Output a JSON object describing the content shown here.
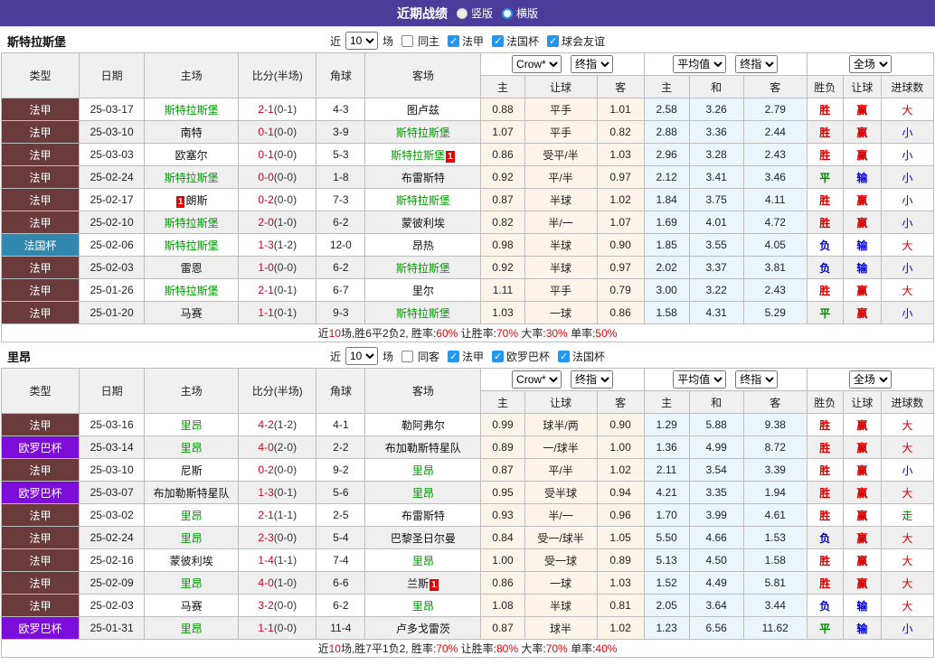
{
  "title_bar": {
    "title": "近期战绩",
    "options": [
      {
        "label": "竖版",
        "selected": true
      },
      {
        "label": "横版",
        "selected": false
      }
    ]
  },
  "colors": {
    "title_bar_bg": "#4b3c99",
    "focus_team": "#009900",
    "score_red": "#cc0022",
    "league_colors": {
      "法甲": "#6b3a3a",
      "法国杯": "#3187ad",
      "欧罗巴杯": "#7d0ddb"
    },
    "result_colors": {
      "胜": "#d60000",
      "赢": "#d60000",
      "大": "#d60000",
      "负": "#0000d6",
      "输": "#0000d6",
      "小": "#0000d6",
      "平": "#008800",
      "走": "#008800"
    }
  },
  "header": {
    "cols": [
      "类型",
      "日期",
      "主场",
      "比分(半场)",
      "角球",
      "客场"
    ],
    "selects": {
      "book": "Crow*",
      "final1": "终指",
      "avg": "平均值",
      "final2": "终指",
      "full": "全场"
    },
    "sub": [
      "主",
      "让球",
      "客",
      "主",
      "和",
      "客",
      "胜负",
      "让球",
      "进球数"
    ]
  },
  "sections": [
    {
      "team": "斯特拉斯堡",
      "filter": {
        "prefix": "近",
        "count": "10",
        "suffix": "场",
        "venue": "同主",
        "leagues": [
          "法甲",
          "法国杯",
          "球会友谊"
        ]
      },
      "rows": [
        {
          "type": "法甲",
          "date": "25-03-17",
          "home": {
            "name": "斯特拉斯堡",
            "focus": true
          },
          "score": "2-1",
          "half": "(0-1)",
          "corner": "4-3",
          "away": {
            "name": "图卢兹",
            "focus": false
          },
          "crow": [
            "0.88",
            "平手",
            "1.01"
          ],
          "avg": [
            "2.58",
            "3.26",
            "2.79"
          ],
          "result": [
            "胜",
            "赢",
            "大"
          ]
        },
        {
          "type": "法甲",
          "date": "25-03-10",
          "home": {
            "name": "南特",
            "focus": false
          },
          "score": "0-1",
          "half": "(0-0)",
          "corner": "3-9",
          "away": {
            "name": "斯特拉斯堡",
            "focus": true
          },
          "crow": [
            "1.07",
            "平手",
            "0.82"
          ],
          "avg": [
            "2.88",
            "3.36",
            "2.44"
          ],
          "result": [
            "胜",
            "赢",
            "小"
          ]
        },
        {
          "type": "法甲",
          "date": "25-03-03",
          "home": {
            "name": "欧塞尔",
            "focus": false
          },
          "score": "0-1",
          "half": "(0-0)",
          "corner": "5-3",
          "away": {
            "name": "斯特拉斯堡",
            "focus": true,
            "badge": "1",
            "badge_pos": "after"
          },
          "crow": [
            "0.86",
            "受平/半",
            "1.03"
          ],
          "avg": [
            "2.96",
            "3.28",
            "2.43"
          ],
          "result": [
            "胜",
            "赢",
            "小"
          ]
        },
        {
          "type": "法甲",
          "date": "25-02-24",
          "home": {
            "name": "斯特拉斯堡",
            "focus": true
          },
          "score": "0-0",
          "half": "(0-0)",
          "corner": "1-8",
          "away": {
            "name": "布雷斯特",
            "focus": false
          },
          "crow": [
            "0.92",
            "平/半",
            "0.97"
          ],
          "avg": [
            "2.12",
            "3.41",
            "3.46"
          ],
          "result": [
            "平",
            "输",
            "小"
          ]
        },
        {
          "type": "法甲",
          "date": "25-02-17",
          "home": {
            "name": "朗斯",
            "focus": false,
            "badge": "1",
            "badge_pos": "before"
          },
          "score": "0-2",
          "half": "(0-0)",
          "corner": "7-3",
          "away": {
            "name": "斯特拉斯堡",
            "focus": true
          },
          "crow": [
            "0.87",
            "半球",
            "1.02"
          ],
          "avg": [
            "1.84",
            "3.75",
            "4.11"
          ],
          "result": [
            "胜",
            "赢",
            "小"
          ]
        },
        {
          "type": "法甲",
          "date": "25-02-10",
          "home": {
            "name": "斯特拉斯堡",
            "focus": true
          },
          "score": "2-0",
          "half": "(1-0)",
          "corner": "6-2",
          "away": {
            "name": "蒙彼利埃",
            "focus": false
          },
          "crow": [
            "0.82",
            "半/一",
            "1.07"
          ],
          "avg": [
            "1.69",
            "4.01",
            "4.72"
          ],
          "result": [
            "胜",
            "赢",
            "小"
          ]
        },
        {
          "type": "法国杯",
          "date": "25-02-06",
          "home": {
            "name": "斯特拉斯堡",
            "focus": true
          },
          "score": "1-3",
          "half": "(1-2)",
          "corner": "12-0",
          "away": {
            "name": "昂热",
            "focus": false
          },
          "crow": [
            "0.98",
            "半球",
            "0.90"
          ],
          "avg": [
            "1.85",
            "3.55",
            "4.05"
          ],
          "result": [
            "负",
            "输",
            "大"
          ]
        },
        {
          "type": "法甲",
          "date": "25-02-03",
          "home": {
            "name": "雷恩",
            "focus": false
          },
          "score": "1-0",
          "half": "(0-0)",
          "corner": "6-2",
          "away": {
            "name": "斯特拉斯堡",
            "focus": true
          },
          "crow": [
            "0.92",
            "半球",
            "0.97"
          ],
          "avg": [
            "2.02",
            "3.37",
            "3.81"
          ],
          "result": [
            "负",
            "输",
            "小"
          ]
        },
        {
          "type": "法甲",
          "date": "25-01-26",
          "home": {
            "name": "斯特拉斯堡",
            "focus": true
          },
          "score": "2-1",
          "half": "(0-1)",
          "corner": "6-7",
          "away": {
            "name": "里尔",
            "focus": false
          },
          "crow": [
            "1.11",
            "平手",
            "0.79"
          ],
          "avg": [
            "3.00",
            "3.22",
            "2.43"
          ],
          "result": [
            "胜",
            "赢",
            "大"
          ]
        },
        {
          "type": "法甲",
          "date": "25-01-20",
          "home": {
            "name": "马赛",
            "focus": false
          },
          "score": "1-1",
          "half": "(0-1)",
          "corner": "9-3",
          "away": {
            "name": "斯特拉斯堡",
            "focus": true
          },
          "crow": [
            "1.03",
            "一球",
            "0.86"
          ],
          "avg": [
            "1.58",
            "4.31",
            "5.29"
          ],
          "result": [
            "平",
            "赢",
            "小"
          ]
        }
      ],
      "summary": [
        {
          "text": "近",
          "red": false
        },
        {
          "text": "10",
          "red": true
        },
        {
          "text": "场,胜6平2负2, 胜率:",
          "red": false
        },
        {
          "text": "60%",
          "red": true
        },
        {
          "text": " 让胜率:",
          "red": false
        },
        {
          "text": "70%",
          "red": true
        },
        {
          "text": " 大率:",
          "red": false
        },
        {
          "text": "30%",
          "red": true
        },
        {
          "text": " 单率:",
          "red": false
        },
        {
          "text": "50%",
          "red": true
        }
      ]
    },
    {
      "team": "里昂",
      "filter": {
        "prefix": "近",
        "count": "10",
        "suffix": "场",
        "venue": "同客",
        "leagues": [
          "法甲",
          "欧罗巴杯",
          "法国杯"
        ]
      },
      "rows": [
        {
          "type": "法甲",
          "date": "25-03-16",
          "home": {
            "name": "里昂",
            "focus": true
          },
          "score": "4-2",
          "half": "(1-2)",
          "corner": "4-1",
          "away": {
            "name": "勒阿弗尔",
            "focus": false
          },
          "crow": [
            "0.99",
            "球半/两",
            "0.90"
          ],
          "avg": [
            "1.29",
            "5.88",
            "9.38"
          ],
          "result": [
            "胜",
            "赢",
            "大"
          ]
        },
        {
          "type": "欧罗巴杯",
          "date": "25-03-14",
          "home": {
            "name": "里昂",
            "focus": true
          },
          "score": "4-0",
          "half": "(2-0)",
          "corner": "2-2",
          "away": {
            "name": "布加勒斯特星队",
            "focus": false
          },
          "crow": [
            "0.89",
            "一/球半",
            "1.00"
          ],
          "avg": [
            "1.36",
            "4.99",
            "8.72"
          ],
          "result": [
            "胜",
            "赢",
            "大"
          ]
        },
        {
          "type": "法甲",
          "date": "25-03-10",
          "home": {
            "name": "尼斯",
            "focus": false
          },
          "score": "0-2",
          "half": "(0-0)",
          "corner": "9-2",
          "away": {
            "name": "里昂",
            "focus": true
          },
          "crow": [
            "0.87",
            "平/半",
            "1.02"
          ],
          "avg": [
            "2.11",
            "3.54",
            "3.39"
          ],
          "result": [
            "胜",
            "赢",
            "小"
          ]
        },
        {
          "type": "欧罗巴杯",
          "date": "25-03-07",
          "home": {
            "name": "布加勒斯特星队",
            "focus": false
          },
          "score": "1-3",
          "half": "(0-1)",
          "corner": "5-6",
          "away": {
            "name": "里昂",
            "focus": true
          },
          "crow": [
            "0.95",
            "受半球",
            "0.94"
          ],
          "avg": [
            "4.21",
            "3.35",
            "1.94"
          ],
          "result": [
            "胜",
            "赢",
            "大"
          ]
        },
        {
          "type": "法甲",
          "date": "25-03-02",
          "home": {
            "name": "里昂",
            "focus": true
          },
          "score": "2-1",
          "half": "(1-1)",
          "corner": "2-5",
          "away": {
            "name": "布雷斯特",
            "focus": false
          },
          "crow": [
            "0.93",
            "半/一",
            "0.96"
          ],
          "avg": [
            "1.70",
            "3.99",
            "4.61"
          ],
          "result": [
            "胜",
            "赢",
            "走"
          ]
        },
        {
          "type": "法甲",
          "date": "25-02-24",
          "home": {
            "name": "里昂",
            "focus": true
          },
          "score": "2-3",
          "half": "(0-0)",
          "corner": "5-4",
          "away": {
            "name": "巴黎圣日尔曼",
            "focus": false
          },
          "crow": [
            "0.84",
            "受一/球半",
            "1.05"
          ],
          "avg": [
            "5.50",
            "4.66",
            "1.53"
          ],
          "result": [
            "负",
            "赢",
            "大"
          ]
        },
        {
          "type": "法甲",
          "date": "25-02-16",
          "home": {
            "name": "蒙彼利埃",
            "focus": false
          },
          "score": "1-4",
          "half": "(1-1)",
          "corner": "7-4",
          "away": {
            "name": "里昂",
            "focus": true
          },
          "crow": [
            "1.00",
            "受一球",
            "0.89"
          ],
          "avg": [
            "5.13",
            "4.50",
            "1.58"
          ],
          "result": [
            "胜",
            "赢",
            "大"
          ]
        },
        {
          "type": "法甲",
          "date": "25-02-09",
          "home": {
            "name": "里昂",
            "focus": true
          },
          "score": "4-0",
          "half": "(1-0)",
          "corner": "6-6",
          "away": {
            "name": "兰斯",
            "focus": false,
            "badge": "1",
            "badge_pos": "after"
          },
          "crow": [
            "0.86",
            "一球",
            "1.03"
          ],
          "avg": [
            "1.52",
            "4.49",
            "5.81"
          ],
          "result": [
            "胜",
            "赢",
            "大"
          ]
        },
        {
          "type": "法甲",
          "date": "25-02-03",
          "home": {
            "name": "马赛",
            "focus": false
          },
          "score": "3-2",
          "half": "(0-0)",
          "corner": "6-2",
          "away": {
            "name": "里昂",
            "focus": true
          },
          "crow": [
            "1.08",
            "半球",
            "0.81"
          ],
          "avg": [
            "2.05",
            "3.64",
            "3.44"
          ],
          "result": [
            "负",
            "输",
            "大"
          ]
        },
        {
          "type": "欧罗巴杯",
          "date": "25-01-31",
          "home": {
            "name": "里昂",
            "focus": true
          },
          "score": "1-1",
          "half": "(0-0)",
          "corner": "11-4",
          "away": {
            "name": "卢多戈雷茨",
            "focus": false
          },
          "crow": [
            "0.87",
            "球半",
            "1.02"
          ],
          "avg": [
            "1.23",
            "6.56",
            "11.62"
          ],
          "result": [
            "平",
            "输",
            "小"
          ]
        }
      ],
      "summary": [
        {
          "text": "近",
          "red": false
        },
        {
          "text": "10",
          "red": true
        },
        {
          "text": "场,胜7平1负2, 胜率:",
          "red": false
        },
        {
          "text": "70%",
          "red": true
        },
        {
          "text": " 让胜率:",
          "red": false
        },
        {
          "text": "80%",
          "red": true
        },
        {
          "text": " 大率:",
          "red": false
        },
        {
          "text": "70%",
          "red": true
        },
        {
          "text": " 单率:",
          "red": false
        },
        {
          "text": "40%",
          "red": true
        }
      ]
    }
  ]
}
